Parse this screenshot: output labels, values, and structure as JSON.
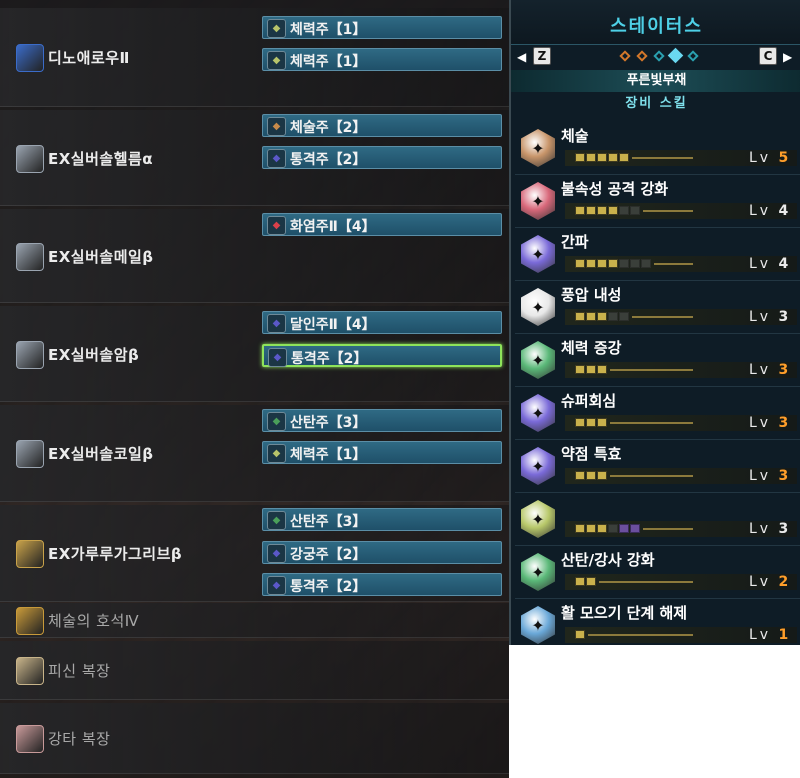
{
  "equipment": [
    {
      "name": "디노애로우Ⅱ",
      "icon": "bow-weapon-icon",
      "icon_color": "#3b6cc9",
      "decorations": [
        {
          "label": "체력주【1】",
          "gem": "jewel-lv1-icon",
          "gem_color": "#b7c46a"
        },
        {
          "label": "체력주【1】",
          "gem": "jewel-lv1-icon",
          "gem_color": "#b7c46a"
        }
      ]
    },
    {
      "name": "EX실버솔헬름α",
      "icon": "helm-icon",
      "icon_color": "#9aa4b0",
      "decorations": [
        {
          "label": "체술주【2】",
          "gem": "jewel-lv2-icon",
          "gem_color": "#c68a4a"
        },
        {
          "label": "통격주【2】",
          "gem": "jewel-lv2-icon",
          "gem_color": "#5b58c9"
        }
      ]
    },
    {
      "name": "EX실버솔메일β",
      "icon": "chest-armor-icon",
      "icon_color": "#9aa4b0",
      "decorations": [
        {
          "label": "화염주Ⅱ【4】",
          "gem": "jewel-lv4-icon",
          "gem_color": "#d9404a"
        }
      ]
    },
    {
      "name": "EX실버솔암β",
      "icon": "arm-armor-icon",
      "icon_color": "#9aa4b0",
      "decorations": [
        {
          "label": "달인주Ⅱ【4】",
          "gem": "jewel-lv4-icon",
          "gem_color": "#5b58c9"
        },
        {
          "label": "통격주【2】",
          "gem": "jewel-lv2-icon",
          "gem_color": "#5b58c9",
          "selected": true
        }
      ]
    },
    {
      "name": "EX실버솔코일β",
      "icon": "waist-armor-icon",
      "icon_color": "#9aa4b0",
      "decorations": [
        {
          "label": "산탄주【3】",
          "gem": "jewel-lv3-icon",
          "gem_color": "#4aa05a"
        },
        {
          "label": "체력주【1】",
          "gem": "jewel-lv1-icon",
          "gem_color": "#b7c46a"
        }
      ]
    },
    {
      "name": "EX가루루가그리브β",
      "icon": "leg-armor-icon",
      "icon_color": "#c8a24a",
      "decorations": [
        {
          "label": "산탄주【3】",
          "gem": "jewel-lv3-icon",
          "gem_color": "#4aa05a"
        },
        {
          "label": "강궁주【2】",
          "gem": "jewel-lv2-icon",
          "gem_color": "#5b58c9"
        },
        {
          "label": "통격주【2】",
          "gem": "jewel-lv2-icon",
          "gem_color": "#5b58c9"
        }
      ]
    },
    {
      "name": "체술의 호석Ⅳ",
      "icon": "charm-icon",
      "icon_color": "#c89a3a",
      "decorations": []
    },
    {
      "name": "피신 복장",
      "icon": "mantle-icon",
      "icon_color": "#c8b48a",
      "decorations": []
    },
    {
      "name": "강타 복장",
      "icon": "mantle-icon",
      "icon_color": "#c89a9a",
      "decorations": []
    }
  ],
  "status": {
    "title": "스테이터스",
    "left_key": "Z",
    "right_key": "C",
    "pager": {
      "count": 5,
      "active_index": 3,
      "colors": [
        "#d4782a",
        "#d4782a",
        "#2aa0b0",
        "#6ad8f0",
        "#2aa0b0"
      ]
    },
    "armor_set": "푸른빛부채",
    "subtitle": "장비 스킬",
    "level_prefix": "Lv",
    "skills": [
      {
        "name": "체술",
        "level": "5",
        "max": 5,
        "ext": 0,
        "icon": "skill-stamina-icon",
        "color": "#c8956a",
        "maxed": true
      },
      {
        "name": "불속성 공격 강화",
        "level": "4",
        "max": 6,
        "ext": 0,
        "icon": "skill-fire-icon",
        "color": "#d8687a",
        "maxed": false
      },
      {
        "name": "간파",
        "level": "4",
        "max": 7,
        "ext": 0,
        "icon": "skill-critical-eye-icon",
        "color": "#7a6ad8",
        "maxed": false
      },
      {
        "name": "풍압 내성",
        "level": "3",
        "max": 5,
        "ext": 0,
        "icon": "skill-windproof-icon",
        "color": "#e8e8e8",
        "maxed": false
      },
      {
        "name": "체력 증강",
        "level": "3",
        "max": 3,
        "ext": 0,
        "icon": "skill-health-icon",
        "color": "#5ab878",
        "maxed": true
      },
      {
        "name": "슈퍼회심",
        "level": "3",
        "max": 3,
        "ext": 0,
        "icon": "skill-critical-boost-icon",
        "color": "#7a6ad8",
        "maxed": true
      },
      {
        "name": "약점 특효",
        "level": "3",
        "max": 3,
        "ext": 0,
        "icon": "skill-weakness-exploit-icon",
        "color": "#7a6ad8",
        "maxed": true
      },
      {
        "name": "",
        "level": "3",
        "max": 4,
        "ext": 2,
        "icon": "skill-set-bonus-icon",
        "color": "#b8c86a",
        "maxed": false
      },
      {
        "name": "산탄/강사 강화",
        "level": "2",
        "max": 2,
        "ext": 0,
        "icon": "skill-spread-shot-icon",
        "color": "#5ab878",
        "maxed": true
      },
      {
        "name": "활 모으기 단계 해제",
        "level": "1",
        "max": 1,
        "ext": 0,
        "icon": "skill-bow-charge-icon",
        "color": "#6aa8d8",
        "maxed": true
      }
    ]
  }
}
